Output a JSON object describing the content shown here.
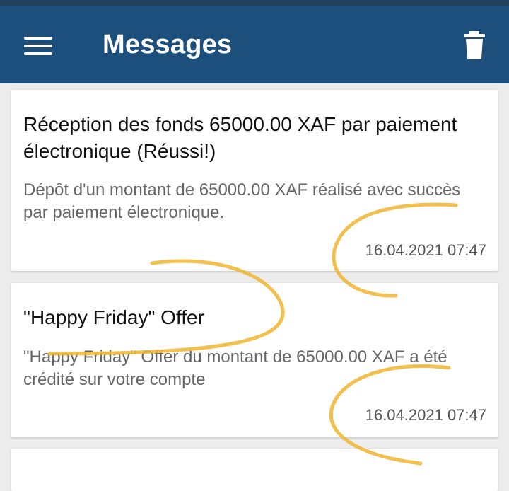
{
  "app_bar": {
    "title": "Messages",
    "menu_icon": "hamburger-menu-icon",
    "delete_icon": "trash-icon",
    "color": "#1d4f7c"
  },
  "messages": [
    {
      "title": "Réception des fonds 65000.00 XAF par paiement électronique (Réussi!)",
      "body": "Dépôt d'un montant de 65000.00 XAF réalisé avec succès par paiement électronique.",
      "date": "16.04.2021 07:47"
    },
    {
      "title": "\"Happy Friday\" Offer",
      "body": "\"Happy Friday\" Offer du montant de 65000.00 XAF a été crédité sur votre compte",
      "date": "16.04.2021 07:47"
    }
  ]
}
